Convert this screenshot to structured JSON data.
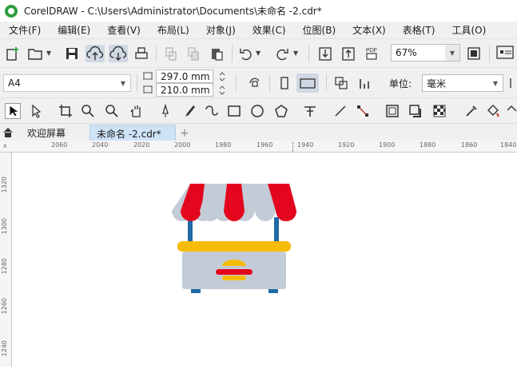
{
  "window": {
    "title": "CorelDRAW - C:\\Users\\Administrator\\Documents\\未命名 -2.cdr*"
  },
  "menu": [
    {
      "label": "文件(F)"
    },
    {
      "label": "编辑(E)"
    },
    {
      "label": "查看(V)"
    },
    {
      "label": "布局(L)"
    },
    {
      "label": "对象(J)"
    },
    {
      "label": "效果(C)"
    },
    {
      "label": "位图(B)"
    },
    {
      "label": "文本(X)"
    },
    {
      "label": "表格(T)"
    },
    {
      "label": "工具(O)"
    }
  ],
  "standard_toolbar": {
    "zoom": "67%",
    "pdf_label": "PDF"
  },
  "property_bar": {
    "page_size": "A4",
    "width": "297.0 mm",
    "height": "210.0 mm",
    "units_label": "单位:",
    "units_value": "毫米"
  },
  "tabs": {
    "welcome": "欢迎屏幕",
    "document": "未命名 -2.cdr*",
    "add": "+"
  },
  "ruler": {
    "h_labels": [
      "2060",
      "2040",
      "2020",
      "2000",
      "1980",
      "1960",
      "1940",
      "1920",
      "1900",
      "1880",
      "1860",
      "1840"
    ],
    "v_labels": [
      "1320",
      "1300",
      "1280",
      "1260",
      "1240"
    ],
    "unit": "ㅊ"
  },
  "colors": {
    "awning_red": "#e3061e",
    "awning_grey": "#c3ccd6",
    "pole_blue": "#1f6aa5",
    "counter_yellow": "#f7bb0a",
    "body_grey": "#c3ccd6"
  },
  "icons": [
    "new-doc-icon",
    "open-icon",
    "save-icon",
    "cloud-upload-icon",
    "cloud-download-icon",
    "print-icon",
    "undo-icon",
    "redo-icon",
    "import-icon",
    "export-icon",
    "pdf-icon",
    "zoom-fit-icon",
    "options-icon"
  ]
}
